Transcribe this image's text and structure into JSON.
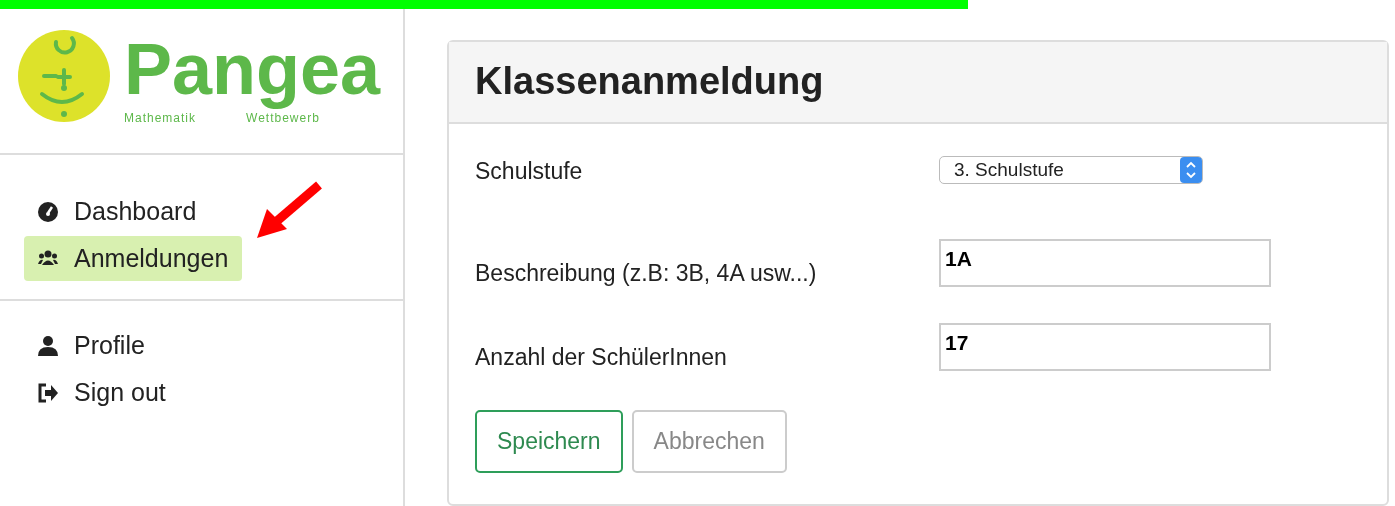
{
  "logo": {
    "name": "Pangea",
    "left_tagline": "Mathematik",
    "right_tagline": "Wettbewerb"
  },
  "nav_groups": [
    [
      {
        "label": "Dashboard",
        "kind": "dashboard",
        "selected": false
      },
      {
        "label": "Anmeldungen",
        "kind": "users",
        "selected": true
      }
    ],
    [
      {
        "label": "Profile",
        "kind": "user",
        "selected": false
      },
      {
        "label": "Sign out",
        "kind": "signout",
        "selected": false
      }
    ]
  ],
  "panel": {
    "title": "Klassenanmeldung",
    "fields": [
      {
        "kind": "select",
        "label": "Schulstufe",
        "value": "3. Schulstufe"
      },
      {
        "kind": "text",
        "label": "Beschreibung (z.B: 3B, 4A usw...)",
        "value": "1A"
      },
      {
        "kind": "text",
        "label": "Anzahl der SchülerInnen",
        "value": "17"
      }
    ],
    "buttons": [
      {
        "label": "Speichern",
        "kind": "primary"
      },
      {
        "label": "Abbrechen",
        "kind": "default"
      }
    ]
  }
}
